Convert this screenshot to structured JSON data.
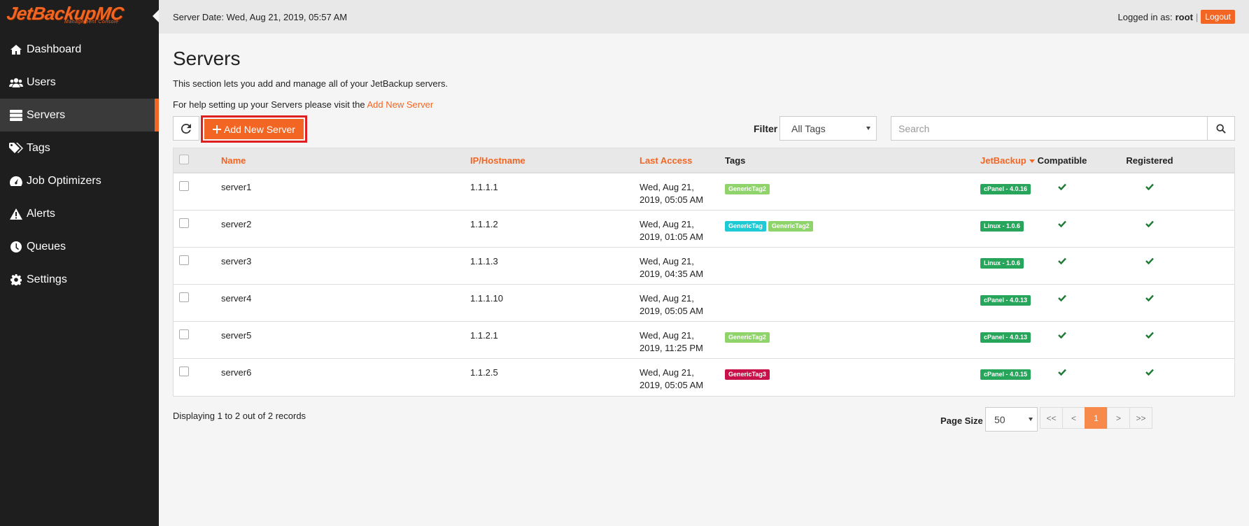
{
  "brand": {
    "name": "JetBackupMC",
    "subtitle": "Management Console"
  },
  "sidebar": {
    "items": [
      {
        "label": "Dashboard",
        "icon": "home-icon"
      },
      {
        "label": "Users",
        "icon": "users-icon"
      },
      {
        "label": "Servers",
        "icon": "servers-icon",
        "active": true
      },
      {
        "label": "Tags",
        "icon": "tags-icon"
      },
      {
        "label": "Job Optimizers",
        "icon": "tachometer-icon"
      },
      {
        "label": "Alerts",
        "icon": "warning-icon"
      },
      {
        "label": "Queues",
        "icon": "clock-icon"
      },
      {
        "label": "Settings",
        "icon": "gear-icon"
      }
    ]
  },
  "topbar": {
    "server_date": "Server Date: Wed, Aug 21, 2019, 05:57 AM",
    "logged_in_label": "Logged in as:",
    "username": "root",
    "separator": "|",
    "logout_label": "Logout"
  },
  "page": {
    "title": "Servers",
    "description": "This section lets you add and manage all of your JetBackup servers.",
    "help_prefix": "For help setting up your Servers please visit the",
    "help_link": "Add New Server"
  },
  "toolbar": {
    "add_button_label": "Add New Server",
    "filter_label": "Filter",
    "filter_value": "All Tags",
    "search_placeholder": "Search"
  },
  "table": {
    "headers": {
      "name": "Name",
      "ip": "IP/Hostname",
      "last_access": "Last Access",
      "tags": "Tags",
      "jetbackup": "JetBackup",
      "compatible": "Compatible",
      "registered": "Registered"
    },
    "rows": [
      {
        "name": "server1",
        "ip": "1.1.1.1",
        "access1": "Wed, Aug 21,",
        "access2": "2019, 05:05 AM",
        "tags": [
          {
            "label": "GenericTag2",
            "color": "#8fd36b"
          }
        ],
        "jetbackup": "cPanel - 4.0.16"
      },
      {
        "name": "server2",
        "ip": "1.1.1.2",
        "access1": "Wed, Aug 21,",
        "access2": "2019, 01:05 AM",
        "tags": [
          {
            "label": "GenericTag",
            "color": "#1ecad4"
          },
          {
            "label": "GenericTag2",
            "color": "#8fd36b"
          }
        ],
        "jetbackup": "Linux - 1.0.6"
      },
      {
        "name": "server3",
        "ip": "1.1.1.3",
        "access1": "Wed, Aug 21,",
        "access2": "2019, 04:35 AM",
        "tags": [],
        "jetbackup": "Linux - 1.0.6"
      },
      {
        "name": "server4",
        "ip": "1.1.1.10",
        "access1": "Wed, Aug 21,",
        "access2": "2019, 05:05 AM",
        "tags": [],
        "jetbackup": "cPanel - 4.0.13"
      },
      {
        "name": "server5",
        "ip": "1.1.2.1",
        "access1": "Wed, Aug 21,",
        "access2": "2019, 11:25 PM",
        "tags": [
          {
            "label": "GenericTag2",
            "color": "#8fd36b"
          }
        ],
        "jetbackup": "cPanel - 4.0.13"
      },
      {
        "name": "server6",
        "ip": "1.1.2.5",
        "access1": "Wed, Aug 21,",
        "access2": "2019, 05:05 AM",
        "tags": [
          {
            "label": "GenericTag3",
            "color": "#c8104a"
          }
        ],
        "jetbackup": "cPanel - 4.0.15"
      }
    ]
  },
  "footer": {
    "records_text": "Displaying 1 to 2 out of 2 records",
    "page_size_label": "Page Size",
    "page_size_value": "50",
    "pager": [
      "<<",
      "<",
      "1",
      ">",
      ">>"
    ],
    "current_page": "1"
  },
  "colors": {
    "accent": "#f26522",
    "sidebar_bg": "#1e1e1e",
    "badge_green": "#27a55a",
    "check_green": "#1e7a34"
  }
}
